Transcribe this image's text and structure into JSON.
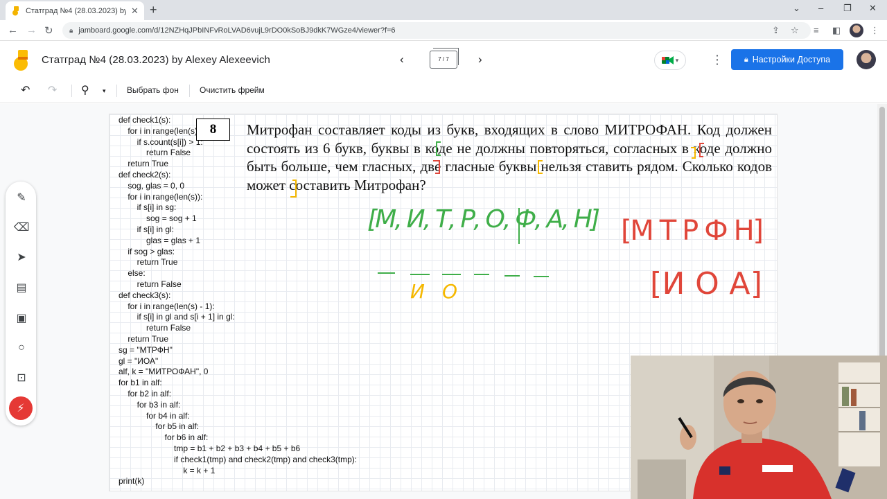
{
  "browser": {
    "tab_title": "Статград №4 (28.03.2023) by Alexey",
    "tab_close": "✕",
    "new_tab": "+",
    "url": "jamboard.google.com/d/12NZHqJPbINFvRoLVAD6vujL9rDO0kSoBJ9dkK7WGze4/viewer?f=6",
    "window_controls": [
      "⌄",
      "–",
      "❐",
      "✕"
    ]
  },
  "jamboard": {
    "title": "Статград №4 (28.03.2023) by Alexey Alexeevich",
    "frame_indicator": "7 / 7",
    "share_label": "Настройки Доступа",
    "toolbar": {
      "set_background": "Выбрать фон",
      "clear_frame": "Очистить фрейм"
    },
    "colors": {
      "brand_yellow": "#fbbc04",
      "share_blue": "#1a73e8",
      "laser_red": "#e53935"
    }
  },
  "board": {
    "task_number": "8",
    "task_text": "Митрофан составляет коды из букв, входящих в слово МИТРОФАН. Код должен состоять из 6 букв, буквы в коде не должны повторяться, согласных в коде должно быть больше, чем гласных, две гласные буквы нельзя ставить рядом. Сколько кодов может составить Митрофан?",
    "code_lines": [
      "def check1(s):",
      "    for i in range(len(s)):",
      "        if s.count(s[i]) > 1:",
      "            return False",
      "    return True",
      "def check2(s):",
      "    sog, glas = 0, 0",
      "    for i in range(len(s)):",
      "        if s[i] in sg:",
      "            sog = sog + 1",
      "        if s[i] in gl:",
      "            glas = glas + 1",
      "    if sog > glas:",
      "        return True",
      "    else:",
      "        return False",
      "def check3(s):",
      "    for i in range(len(s) - 1):",
      "        if s[i] in gl and s[i + 1] in gl:",
      "            return False",
      "    return True",
      "sg = \"МТРФН\"",
      "gl = \"ИОА\"",
      "alf, k = \"МИТРОФАН\", 0",
      "for b1 in alf:",
      "    for b2 in alf:",
      "        for b3 in alf:",
      "            for b4 in alf:",
      "                for b5 in alf:",
      "                    for b6 in alf:",
      "                        tmp = b1 + b2 + b3 + b4 + b5 + b6",
      "                        if check1(tmp) and check2(tmp) and check3(tmp):",
      "                            k = k + 1",
      "print(k)"
    ],
    "handwriting": {
      "green_set": "[М, И, Т, Р, О, Ф, А, Н]",
      "red_consonants": "[М Т Р Ф Н]",
      "red_vowels": "[И О А]",
      "yellow_slots": "И О",
      "green_color": "#3fae49",
      "red_color": "#e0463a",
      "yellow_color": "#f5b800"
    }
  }
}
